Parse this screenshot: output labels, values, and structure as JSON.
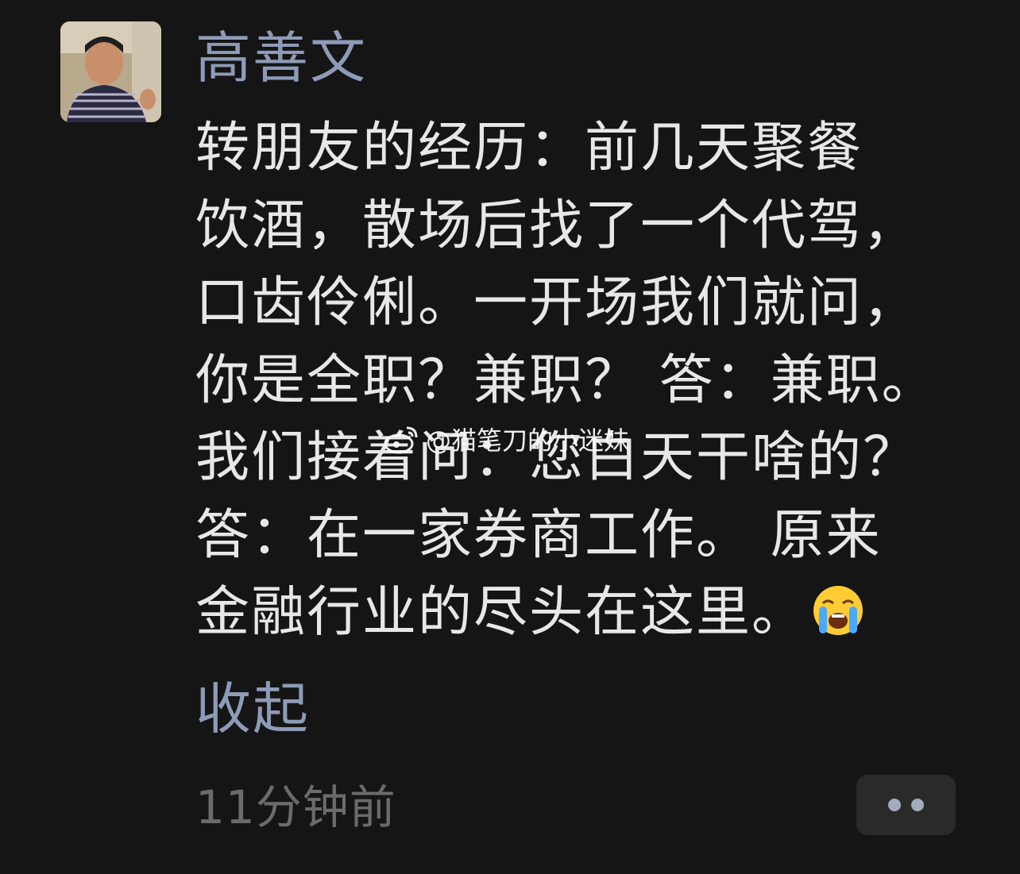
{
  "post": {
    "author": "高善文",
    "avatar_icon": "profile-photo",
    "content_lines": [
      "转朋友的经历：前几天聚餐",
      "饮酒，散场后找了一个代驾，",
      "口齿伶俐。一开场我们就问，",
      "你是全职？兼职？ 答：兼职。",
      "我们接着问：您白天干啥的？",
      " 答：在一家券商工作。 原来",
      "金融行业的尽头在这里。"
    ],
    "emoji": "loudly-crying-face",
    "collapse_label": "收起",
    "timestamp": "11分钟前",
    "more_icon": "more-dots"
  },
  "watermark": {
    "text": "@猫笔刀的小迷妹",
    "icon": "weibo-logo"
  },
  "colors": {
    "background": "#151515",
    "link": "#8e9bb8",
    "text": "#e7e7e7",
    "muted": "#6b6b6b"
  }
}
